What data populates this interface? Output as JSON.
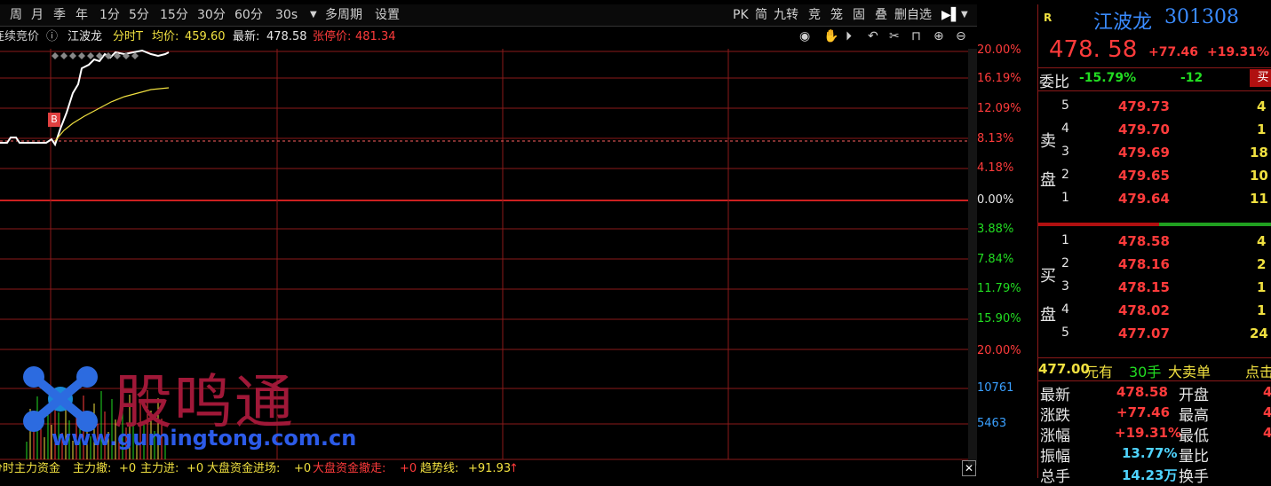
{
  "toolbar": {
    "items": [
      "周",
      "月",
      "季",
      "年",
      "1分",
      "5分",
      "15分",
      "30分",
      "60分",
      "30s",
      "多周期",
      "设置"
    ],
    "right_items": [
      "PK",
      "简",
      "九转",
      "竞",
      "笼",
      "固",
      "叠",
      "删自选"
    ]
  },
  "info": {
    "prefix": "连续竞价",
    "stock_name": "江波龙",
    "chart_mode": "分时T",
    "avg_label": "均价:",
    "avg_value": "459.60",
    "latest_label": "最新:",
    "latest_value": "478.58",
    "limit_label": "张停价:",
    "limit_value": "481.34"
  },
  "price_axis": {
    "upper": [
      "20.00%",
      "16.19%",
      "12.09%",
      "8.13%",
      "4.18%",
      "0.00%",
      "3.88%",
      "7.84%",
      "11.79%",
      "15.90%"
    ],
    "volume": [
      "20.00%",
      "10761",
      "5463"
    ]
  },
  "marker": "B",
  "bottom": {
    "title": "分时主力资金",
    "outflow_label": "主力撤:",
    "outflow_value": "+0",
    "inflow_label": "主力进:",
    "inflow_value": "+0",
    "big_in_label": "大盘资金进场:",
    "big_in_value": "+0",
    "big_out_label": "大盘资金撤走:",
    "big_out_value": "+0",
    "trend_label": "趋势线:",
    "trend_value": "+91.93",
    "trend_arrow": "↑"
  },
  "watermark": {
    "brand": "股鸣通",
    "url": "www.gumingtong.com.cn"
  },
  "panel": {
    "tag": "R",
    "name": "江波龙",
    "code": "301308",
    "price": "478. 58",
    "change": "+77.46",
    "change_pct": "+19.31%",
    "weibi_label": "委比",
    "weibi_pct": "-15.79%",
    "weibi_diff": "-12",
    "buy_btn": "买",
    "sell_label_1": "卖",
    "sell_label_2": "盘",
    "buy_label_1": "买",
    "buy_label_2": "盘",
    "asks": [
      {
        "level": "5",
        "price": "479.73",
        "vol": "4"
      },
      {
        "level": "4",
        "price": "479.70",
        "vol": "1"
      },
      {
        "level": "3",
        "price": "479.69",
        "vol": "18"
      },
      {
        "level": "2",
        "price": "479.65",
        "vol": "10"
      },
      {
        "level": "1",
        "price": "479.64",
        "vol": "11"
      }
    ],
    "bids": [
      {
        "level": "1",
        "price": "478.58",
        "vol": "4"
      },
      {
        "level": "2",
        "price": "478.16",
        "vol": "2"
      },
      {
        "level": "3",
        "price": "478.15",
        "vol": "1"
      },
      {
        "level": "4",
        "price": "478.02",
        "vol": "1"
      },
      {
        "level": "5",
        "price": "477.07",
        "vol": "24"
      }
    ],
    "trade": {
      "price": "477.00",
      "unit": "元有",
      "qty": "30手",
      "type": "大卖单",
      "extra": "点击"
    },
    "stats": [
      {
        "label": "最新",
        "value": "478.58",
        "label2": "开盘",
        "value2": "4"
      },
      {
        "label": "涨跌",
        "value": "+77.46",
        "label2": "最高",
        "value2": "4"
      },
      {
        "label": "涨幅",
        "value": "+19.31%",
        "label2": "最低",
        "value2": "4"
      },
      {
        "label": "振幅",
        "value": "13.77%",
        "label2": "量比",
        "value2": ""
      },
      {
        "label": "总手",
        "value": "14.23万",
        "label2": "换手",
        "value2": ""
      }
    ]
  },
  "colors": {
    "grid": "#8b1a1a",
    "up": "#ff3b3b",
    "down": "#22dd22",
    "avg": "#f0e040"
  }
}
